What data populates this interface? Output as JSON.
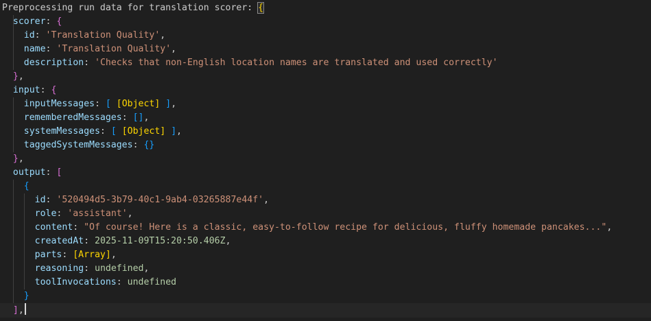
{
  "header": {
    "label": "Preprocessing run data for translation scorer: ",
    "open_brace": "{"
  },
  "scorer": {
    "key": "scorer",
    "open": "{",
    "id_key": "id",
    "id_value": "'Translation Quality'",
    "name_key": "name",
    "name_value": "'Translation Quality'",
    "description_key": "description",
    "description_value": "'Checks that non-English location names are translated and used correctly'",
    "close": "}"
  },
  "input": {
    "key": "input",
    "open": "{",
    "inputMessages_key": "inputMessages",
    "inputMessages_value": "[Object]",
    "rememberedMessages_key": "rememberedMessages",
    "rememberedMessages_value": "[]",
    "systemMessages_key": "systemMessages",
    "systemMessages_value": "[Object]",
    "taggedSystemMessages_key": "taggedSystemMessages",
    "taggedSystemMessages_value": "{}",
    "close": "}"
  },
  "output": {
    "key": "output",
    "open": "[",
    "item_open": "{",
    "id_key": "id",
    "id_value": "'520494d5-3b79-40c1-9ab4-03265887e44f'",
    "role_key": "role",
    "role_value": "'assistant'",
    "content_key": "content",
    "content_value": "\"Of course! Here is a classic, easy-to-follow recipe for delicious, fluffy homemade pancakes...\"",
    "createdAt_key": "createdAt",
    "createdAt_value": "2025-11-09T15:20:50.406Z",
    "parts_key": "parts",
    "parts_value": "[Array]",
    "reasoning_key": "reasoning",
    "reasoning_value": "undefined",
    "toolInvocations_key": "toolInvocations",
    "toolInvocations_value": "undefined",
    "item_close": "}",
    "close": "]"
  },
  "colors": {
    "background": "#1f1f1f",
    "key": "#9cdcfe",
    "string": "#ce9178",
    "bracket_level1": "#ffd700",
    "bracket_level2": "#da70d6",
    "bracket_level3": "#179fff",
    "keyword": "#569cd6"
  }
}
